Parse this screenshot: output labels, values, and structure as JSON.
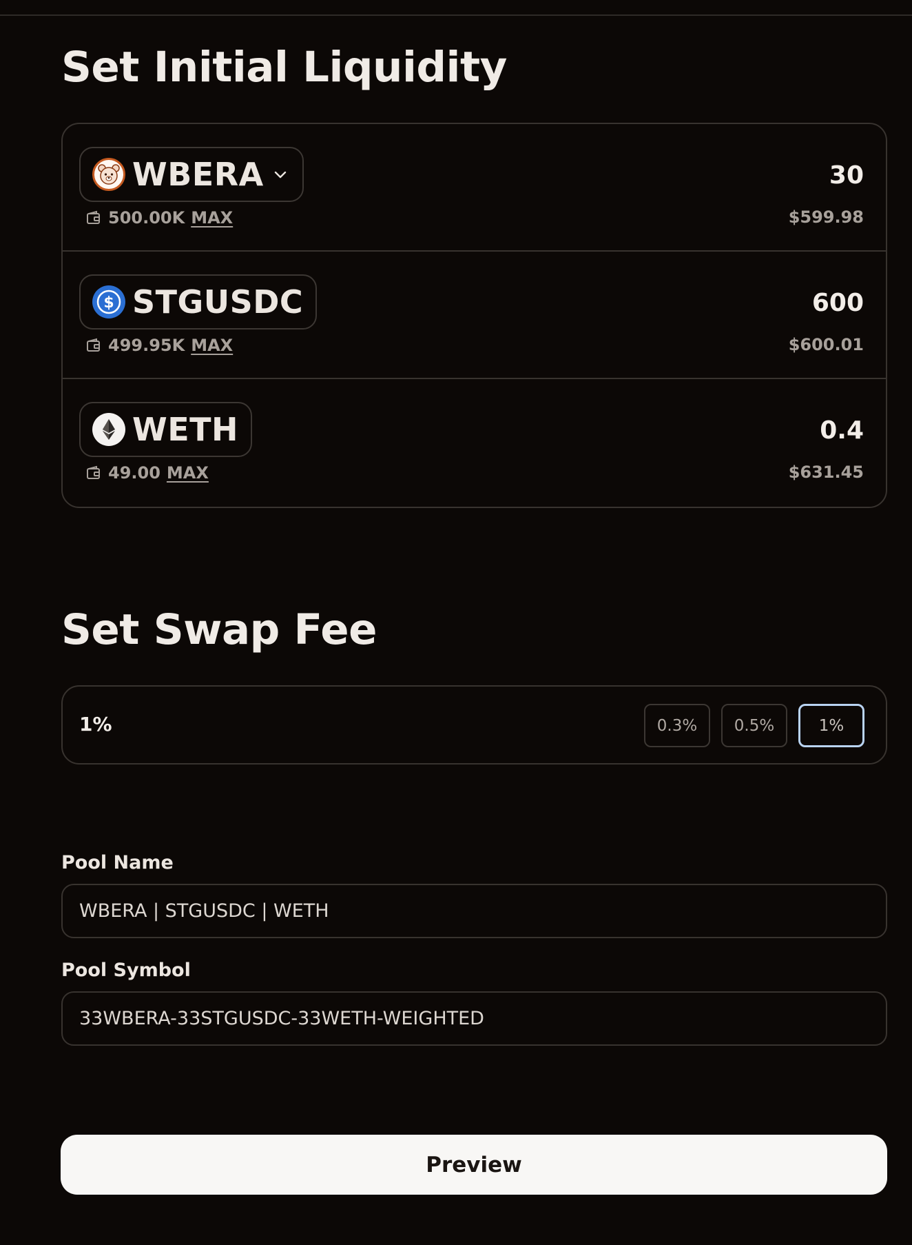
{
  "liquidity": {
    "title": "Set Initial Liquidity",
    "tokens": [
      {
        "symbol": "WBERA",
        "balance": "500.00K",
        "max_label": "MAX",
        "amount": "30",
        "usd": "$599.98",
        "icon": "bear-icon",
        "has_dropdown": true
      },
      {
        "symbol": "STGUSDC",
        "balance": "499.95K",
        "max_label": "MAX",
        "amount": "600",
        "usd": "$600.01",
        "icon": "usdc-icon",
        "has_dropdown": false
      },
      {
        "symbol": "WETH",
        "balance": "49.00",
        "max_label": "MAX",
        "amount": "0.4",
        "usd": "$631.45",
        "icon": "ethereum-icon",
        "has_dropdown": false
      }
    ]
  },
  "swap_fee": {
    "title": "Set Swap Fee",
    "value": "1%",
    "options": [
      "0.3%",
      "0.5%",
      "1%"
    ],
    "selected": "1%"
  },
  "pool": {
    "name_label": "Pool Name",
    "name_value": "WBERA | STGUSDC | WETH",
    "symbol_label": "Pool Symbol",
    "symbol_value": "33WBERA-33STGUSDC-33WETH-WEIGHTED"
  },
  "preview_label": "Preview",
  "colors": {
    "background": "#0c0806",
    "border": "#38332f",
    "selected_fee_border": "#b9d3f2",
    "usdc_blue": "#2b6fd3",
    "bear_orange": "#c4591f",
    "button_bg": "#f8f7f5"
  }
}
